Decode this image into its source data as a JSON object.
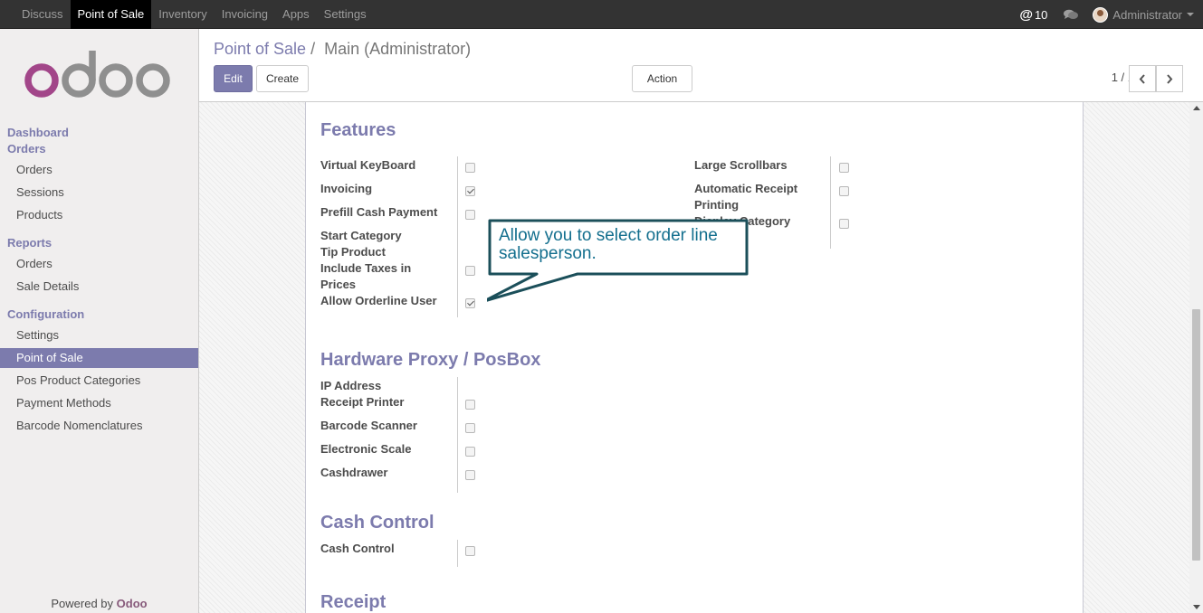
{
  "topbar": {
    "menu": [
      "Discuss",
      "Point of Sale",
      "Inventory",
      "Invoicing",
      "Apps",
      "Settings"
    ],
    "active_menu": "Point of Sale",
    "notifications": "10",
    "user_name": "Administrator"
  },
  "sidebar": {
    "logo": "odoo",
    "sections": [
      {
        "title": "Dashboard"
      },
      {
        "title": "Orders",
        "items": [
          "Orders",
          "Sessions",
          "Products"
        ]
      },
      {
        "title": "Reports",
        "items": [
          "Orders",
          "Sale Details"
        ]
      },
      {
        "title": "Configuration",
        "items": [
          "Settings",
          "Point of Sale",
          "Pos Product Categories",
          "Payment Methods",
          "Barcode Nomenclatures"
        ]
      }
    ],
    "active_item": "Point of Sale",
    "powered_by": "Powered by",
    "powered_brand": "Odoo"
  },
  "control": {
    "breadcrumb_parent": "Point of Sale",
    "breadcrumb_sep": "/",
    "breadcrumb_current": "Main (Administrator)",
    "edit_label": "Edit",
    "create_label": "Create",
    "action_label": "Action",
    "pager": "1 / 1"
  },
  "form": {
    "features_title": "Features",
    "features_left": [
      {
        "label": "Virtual KeyBoard",
        "checked": false
      },
      {
        "label": "Invoicing",
        "checked": true
      },
      {
        "label": "Prefill Cash Payment",
        "checked": false
      },
      {
        "label": "Start Category"
      },
      {
        "label": "Tip Product"
      },
      {
        "label": "Include Taxes in Prices",
        "checked": false
      },
      {
        "label": "Allow Orderline User",
        "checked": true
      }
    ],
    "features_right": [
      {
        "label": "Large Scrollbars",
        "checked": false
      },
      {
        "label": "Automatic Receipt Printing",
        "checked": false
      },
      {
        "label": "Display Category",
        "checked": false
      }
    ],
    "hardware_title": "Hardware Proxy / PosBox",
    "hardware": [
      {
        "label": "IP Address"
      },
      {
        "label": "Receipt Printer",
        "checked": false
      },
      {
        "label": "Barcode Scanner",
        "checked": false
      },
      {
        "label": "Electronic Scale",
        "checked": false
      },
      {
        "label": "Cashdrawer",
        "checked": false
      }
    ],
    "cash_title": "Cash Control",
    "cash": [
      {
        "label": "Cash Control",
        "checked": false
      }
    ],
    "receipt_title": "Receipt"
  },
  "callout": {
    "text": "Allow you to select order line salesperson."
  },
  "colors": {
    "brand": "#7c7bad",
    "topbar": "#333333",
    "callout_text": "#136f8e"
  }
}
